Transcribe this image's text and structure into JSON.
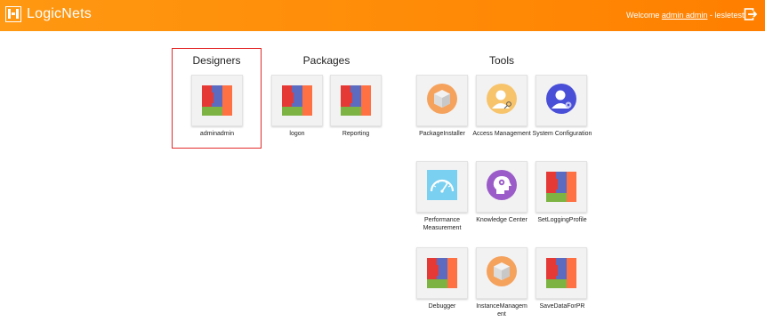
{
  "app": {
    "title": "LogicNets"
  },
  "header": {
    "welcome_prefix": "Welcome",
    "user_link": "admin admin",
    "separator": "-",
    "tenant": "lesletest"
  },
  "sections": {
    "designers": "Designers",
    "packages": "Packages",
    "tools": "Tools"
  },
  "designers": [
    {
      "label": "adminadmin",
      "icon": "logicnets-logo-icon"
    }
  ],
  "packages": [
    {
      "label": "logon",
      "icon": "logicnets-logo-icon"
    },
    {
      "label": "Reporting",
      "icon": "logicnets-logo-icon"
    }
  ],
  "tools": [
    {
      "label": "PackageInstaller",
      "icon": "package-box-icon"
    },
    {
      "label": "Access Management",
      "icon": "user-key-icon"
    },
    {
      "label": "System Configuration",
      "icon": "user-settings-icon"
    },
    {
      "label": "Performance Measurement",
      "icon": "speedometer-icon"
    },
    {
      "label": "Knowledge Center",
      "icon": "head-bulb-icon"
    },
    {
      "label": "SetLoggingProfile",
      "icon": "logicnets-logo-icon"
    },
    {
      "label": "Debugger",
      "icon": "logicnets-logo-icon"
    },
    {
      "label": "InstanceManagement",
      "icon": "package-box-icon"
    },
    {
      "label": "SaveDataForPR",
      "icon": "logicnets-logo-icon"
    }
  ],
  "colors": {
    "header": "#ff8a06",
    "selection_border": "#e32b2b",
    "logo_red": "#e53935",
    "logo_blue": "#5c6bc0",
    "logo_green": "#7cb342",
    "logo_orange": "#ff7043"
  }
}
